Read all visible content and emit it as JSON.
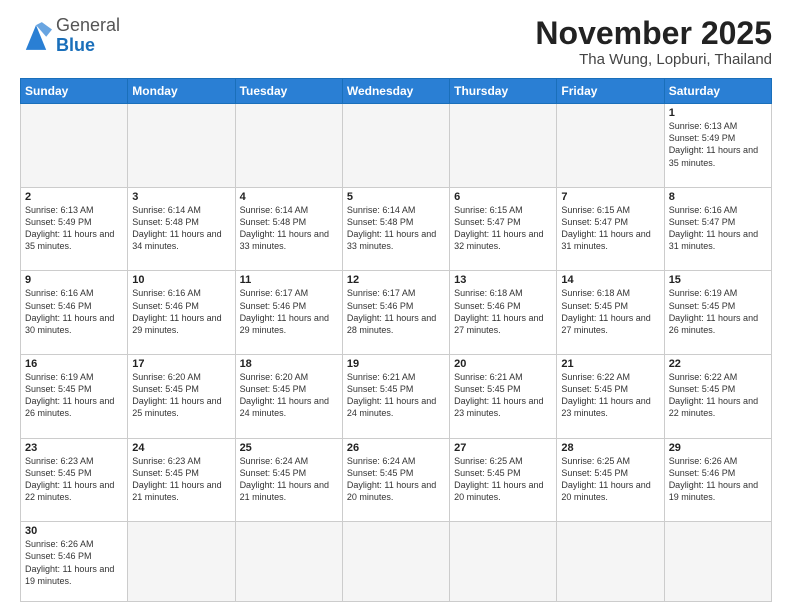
{
  "header": {
    "logo_general": "General",
    "logo_blue": "Blue",
    "month_year": "November 2025",
    "location": "Tha Wung, Lopburi, Thailand"
  },
  "weekdays": [
    "Sunday",
    "Monday",
    "Tuesday",
    "Wednesday",
    "Thursday",
    "Friday",
    "Saturday"
  ],
  "days": {
    "1": {
      "sunrise": "6:13 AM",
      "sunset": "5:49 PM",
      "daylight": "11 hours and 35 minutes."
    },
    "2": {
      "sunrise": "6:13 AM",
      "sunset": "5:49 PM",
      "daylight": "11 hours and 35 minutes."
    },
    "3": {
      "sunrise": "6:14 AM",
      "sunset": "5:48 PM",
      "daylight": "11 hours and 34 minutes."
    },
    "4": {
      "sunrise": "6:14 AM",
      "sunset": "5:48 PM",
      "daylight": "11 hours and 33 minutes."
    },
    "5": {
      "sunrise": "6:14 AM",
      "sunset": "5:48 PM",
      "daylight": "11 hours and 33 minutes."
    },
    "6": {
      "sunrise": "6:15 AM",
      "sunset": "5:47 PM",
      "daylight": "11 hours and 32 minutes."
    },
    "7": {
      "sunrise": "6:15 AM",
      "sunset": "5:47 PM",
      "daylight": "11 hours and 31 minutes."
    },
    "8": {
      "sunrise": "6:16 AM",
      "sunset": "5:47 PM",
      "daylight": "11 hours and 31 minutes."
    },
    "9": {
      "sunrise": "6:16 AM",
      "sunset": "5:46 PM",
      "daylight": "11 hours and 30 minutes."
    },
    "10": {
      "sunrise": "6:16 AM",
      "sunset": "5:46 PM",
      "daylight": "11 hours and 29 minutes."
    },
    "11": {
      "sunrise": "6:17 AM",
      "sunset": "5:46 PM",
      "daylight": "11 hours and 29 minutes."
    },
    "12": {
      "sunrise": "6:17 AM",
      "sunset": "5:46 PM",
      "daylight": "11 hours and 28 minutes."
    },
    "13": {
      "sunrise": "6:18 AM",
      "sunset": "5:46 PM",
      "daylight": "11 hours and 27 minutes."
    },
    "14": {
      "sunrise": "6:18 AM",
      "sunset": "5:45 PM",
      "daylight": "11 hours and 27 minutes."
    },
    "15": {
      "sunrise": "6:19 AM",
      "sunset": "5:45 PM",
      "daylight": "11 hours and 26 minutes."
    },
    "16": {
      "sunrise": "6:19 AM",
      "sunset": "5:45 PM",
      "daylight": "11 hours and 26 minutes."
    },
    "17": {
      "sunrise": "6:20 AM",
      "sunset": "5:45 PM",
      "daylight": "11 hours and 25 minutes."
    },
    "18": {
      "sunrise": "6:20 AM",
      "sunset": "5:45 PM",
      "daylight": "11 hours and 24 minutes."
    },
    "19": {
      "sunrise": "6:21 AM",
      "sunset": "5:45 PM",
      "daylight": "11 hours and 24 minutes."
    },
    "20": {
      "sunrise": "6:21 AM",
      "sunset": "5:45 PM",
      "daylight": "11 hours and 23 minutes."
    },
    "21": {
      "sunrise": "6:22 AM",
      "sunset": "5:45 PM",
      "daylight": "11 hours and 23 minutes."
    },
    "22": {
      "sunrise": "6:22 AM",
      "sunset": "5:45 PM",
      "daylight": "11 hours and 22 minutes."
    },
    "23": {
      "sunrise": "6:23 AM",
      "sunset": "5:45 PM",
      "daylight": "11 hours and 22 minutes."
    },
    "24": {
      "sunrise": "6:23 AM",
      "sunset": "5:45 PM",
      "daylight": "11 hours and 21 minutes."
    },
    "25": {
      "sunrise": "6:24 AM",
      "sunset": "5:45 PM",
      "daylight": "11 hours and 21 minutes."
    },
    "26": {
      "sunrise": "6:24 AM",
      "sunset": "5:45 PM",
      "daylight": "11 hours and 20 minutes."
    },
    "27": {
      "sunrise": "6:25 AM",
      "sunset": "5:45 PM",
      "daylight": "11 hours and 20 minutes."
    },
    "28": {
      "sunrise": "6:25 AM",
      "sunset": "5:45 PM",
      "daylight": "11 hours and 20 minutes."
    },
    "29": {
      "sunrise": "6:26 AM",
      "sunset": "5:46 PM",
      "daylight": "11 hours and 19 minutes."
    },
    "30": {
      "sunrise": "6:26 AM",
      "sunset": "5:46 PM",
      "daylight": "11 hours and 19 minutes."
    }
  },
  "labels": {
    "sunrise": "Sunrise:",
    "sunset": "Sunset:",
    "daylight": "Daylight:"
  }
}
